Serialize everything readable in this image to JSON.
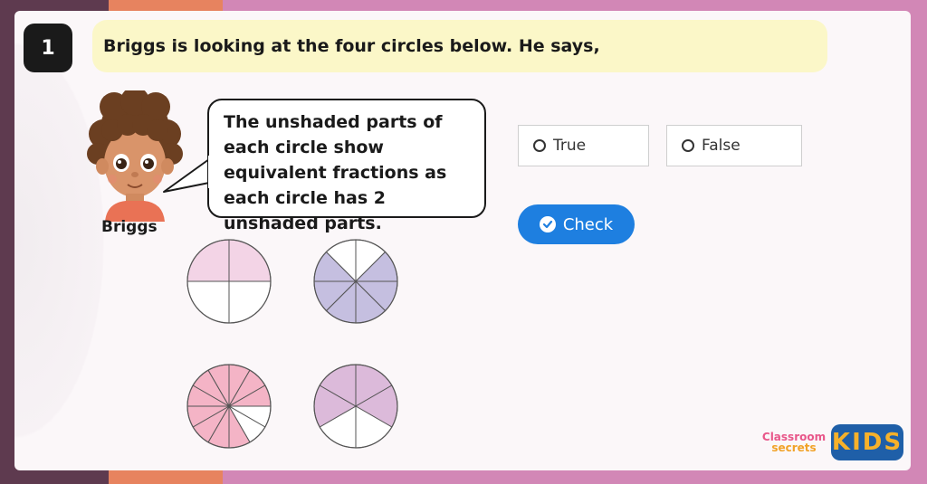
{
  "question": {
    "number": "1",
    "text": "Briggs is looking at the four circles below. He says,"
  },
  "character": {
    "name": "Briggs",
    "speech": "The unshaded parts of each circle show equivalent fractions as each circle has 2 unshaded parts."
  },
  "circles": [
    {
      "parts": 4,
      "unshaded": 2,
      "shade_color": "#f3d4e6"
    },
    {
      "parts": 8,
      "unshaded": 2,
      "shade_color": "#c5bfe0"
    },
    {
      "parts": 12,
      "unshaded": 2,
      "shade_color": "#f4b4c6"
    },
    {
      "parts": 6,
      "unshaded": 2,
      "shade_color": "#dcbada"
    }
  ],
  "options": {
    "true_label": "True",
    "false_label": "False"
  },
  "check": {
    "label": "Check",
    "color": "#1e7fe0"
  },
  "logo": {
    "line1": "Classroom",
    "line2": "secrets",
    "kids": "KIDS"
  }
}
